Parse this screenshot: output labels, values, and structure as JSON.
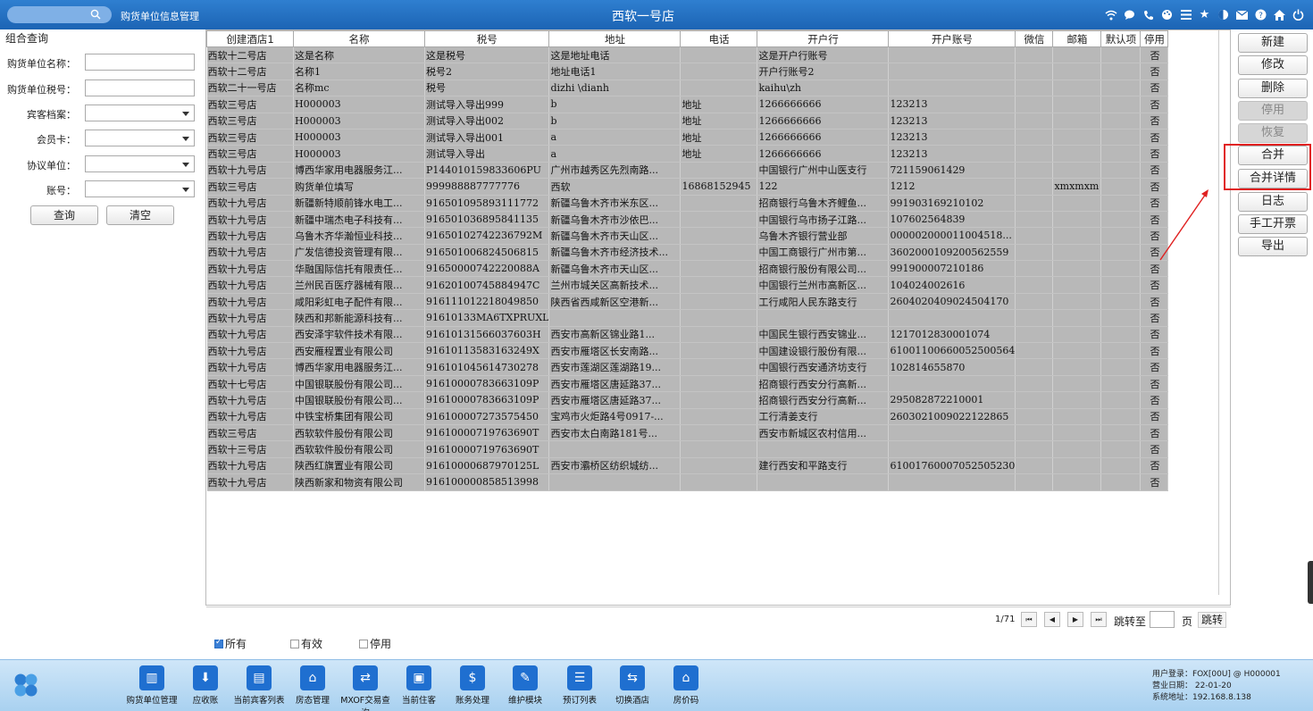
{
  "topbar": {
    "search_placeholder": "",
    "module_title": "购货单位信息管理",
    "store_title": "西软一号店",
    "icons": [
      "wifi-icon",
      "chat-icon",
      "phone-icon",
      "palette-icon",
      "menu-icon",
      "star-icon",
      "moon-icon",
      "mail-icon",
      "help-icon",
      "home-icon",
      "power-icon"
    ]
  },
  "left": {
    "group_title": "组合查询",
    "fields": [
      {
        "label": "购货单位名称：",
        "value": ""
      },
      {
        "label": "购货单位税号：",
        "value": ""
      },
      {
        "label": "宾客档案：",
        "value": ""
      },
      {
        "label": "会员卡：",
        "value": ""
      },
      {
        "label": "协议单位：",
        "value": ""
      },
      {
        "label": "账号：",
        "value": ""
      }
    ],
    "query_label": "查询",
    "clear_label": "清空"
  },
  "grid": {
    "columns": [
      "创建酒店1",
      "名称",
      "税号",
      "地址",
      "电话",
      "开户行",
      "开户账号",
      "微信",
      "邮箱",
      "默认项",
      "停用"
    ],
    "rows": [
      [
        "西软十二号店",
        "这是名称",
        "这是税号",
        "这是地址电话",
        "",
        "这是开户行账号",
        "",
        "",
        "",
        "",
        "否"
      ],
      [
        "西软十二号店",
        "名称1",
        "税号2",
        "地址电话1",
        "",
        "开户行账号2",
        "",
        "",
        "",
        "",
        "否"
      ],
      [
        "西软二十一号店",
        "名称mc",
        "税号",
        "dizhi \\dianh",
        "",
        "kaihu\\zh",
        "",
        "",
        "",
        "",
        "否"
      ],
      [
        "西软三号店",
        "H000003",
        "测试导入导出999",
        "b",
        "地址",
        "1266666666",
        "123213",
        "",
        "",
        "",
        "否"
      ],
      [
        "西软三号店",
        "H000003",
        "测试导入导出002",
        "b",
        "地址",
        "1266666666",
        "123213",
        "",
        "",
        "",
        "否"
      ],
      [
        "西软三号店",
        "H000003",
        "测试导入导出001",
        "a",
        "地址",
        "1266666666",
        "123213",
        "",
        "",
        "",
        "否"
      ],
      [
        "西软三号店",
        "H000003",
        "测试导入导出",
        "a",
        "地址",
        "1266666666",
        "123213",
        "",
        "",
        "",
        "否"
      ],
      [
        "西软十九号店",
        "博西华家用电器服务江...",
        "P144010159833606PU",
        "广州市越秀区先烈南路...",
        "",
        "中国银行广州中山医支行",
        "721159061429",
        "",
        "",
        "",
        "否"
      ],
      [
        "西软三号店",
        "购货单位填写",
        "999988887777776",
        "西软",
        "16868152945",
        "122",
        "1212",
        "",
        "xmxmxm",
        "",
        "否"
      ],
      [
        "西软十九号店",
        "新疆新特顺前锋水电工...",
        "916501095893111772",
        "新疆乌鲁木齐市米东区...",
        "",
        "招商银行乌鲁木齐鲤鱼...",
        "991903169210102",
        "",
        "",
        "",
        "否"
      ],
      [
        "西软十九号店",
        "新疆中瑞杰电子科技有...",
        "916501036895841135",
        "新疆乌鲁木齐市沙依巴...",
        "",
        "中国银行乌市扬子江路...",
        "107602564839",
        "",
        "",
        "",
        "否"
      ],
      [
        "西软十九号店",
        "乌鲁木齐华瀚恒业科技...",
        "91650102742236792M",
        "新疆乌鲁木齐市天山区...",
        "",
        "乌鲁木齐银行营业部",
        "000002000011004518...",
        "",
        "",
        "",
        "否"
      ],
      [
        "西软十九号店",
        "广发信德投资管理有限...",
        "916501006824506815",
        "新疆乌鲁木齐市经济技术...",
        "",
        "中国工商银行广州市第...",
        "3602000109200562559",
        "",
        "",
        "",
        "否"
      ],
      [
        "西软十九号店",
        "华融国际信托有限责任...",
        "91650000742220088A",
        "新疆乌鲁木齐市天山区...",
        "",
        "招商银行股份有限公司...",
        "991900007210186",
        "",
        "",
        "",
        "否"
      ],
      [
        "西软十九号店",
        "兰州民百医疗器械有限...",
        "91620100745884947C",
        "兰州市城关区高新技术...",
        "",
        "中国银行兰州市高新区...",
        "104024002616",
        "",
        "",
        "",
        "否"
      ],
      [
        "西软十九号店",
        "咸阳彩虹电子配件有限...",
        "916111012218049850",
        "陕西省西咸新区空港新...",
        "",
        "工行咸阳人民东路支行",
        "2604020409024504170",
        "",
        "",
        "",
        "否"
      ],
      [
        "西软十九号店",
        "陕西和邦新能源科技有...",
        "91610133MA6TXPRUXL",
        "",
        "",
        "",
        "",
        "",
        "",
        "",
        "否"
      ],
      [
        "西软十九号店",
        "西安泽宇软件技术有限...",
        "91610131566037603H",
        "西安市高新区锦业路1...",
        "",
        "中国民生银行西安锦业...",
        "1217012830001074",
        "",
        "",
        "",
        "否"
      ],
      [
        "西软十九号店",
        "西安雁程置业有限公司",
        "91610113583163249X",
        "西安市雁塔区长安南路...",
        "",
        "中国建设银行股份有限...",
        "61001100660052500564",
        "",
        "",
        "",
        "否"
      ],
      [
        "西软十九号店",
        "博西华家用电器服务江...",
        "916101045614730278",
        "西安市莲湖区莲湖路19...",
        "",
        "中国银行西安通济坊支行",
        "102814655870",
        "",
        "",
        "",
        "否"
      ],
      [
        "西软十七号店",
        "中国银联股份有限公司...",
        "91610000783663109P",
        "西安市雁塔区唐延路37...",
        "",
        "招商银行西安分行高新...",
        "",
        "",
        "",
        "",
        "否"
      ],
      [
        "西软十九号店",
        "中国银联股份有限公司...",
        "91610000783663109P",
        "西安市雁塔区唐延路37...",
        "",
        "招商银行西安分行高新...",
        "295082872210001",
        "",
        "",
        "",
        "否"
      ],
      [
        "西软十九号店",
        "中铁宝桥集团有限公司",
        "916100007273575450",
        "宝鸡市火炬路4号0917-...",
        "",
        "工行清姜支行",
        "2603021009022122865",
        "",
        "",
        "",
        "否"
      ],
      [
        "西软三号店",
        "西软软件股份有限公司",
        "91610000719763690T",
        "西安市太白南路181号...",
        "",
        "西安市新城区农村信用...",
        "",
        "",
        "",
        "",
        "否"
      ],
      [
        "西软十三号店",
        "西软软件股份有限公司",
        "91610000719763690T",
        "",
        "",
        "",
        "",
        "",
        "",
        "",
        "否"
      ],
      [
        "西软十九号店",
        "陕西红旗置业有限公司",
        "91610000687970125L",
        "西安市灞桥区纺织城纺...",
        "",
        "建行西安和平路支行",
        "61001760007052505230",
        "",
        "",
        "",
        "否"
      ],
      [
        "西软十九号店",
        "陕西新家和物资有限公司",
        "916100000858513998",
        "",
        "",
        "",
        "",
        "",
        "",
        "",
        "否"
      ]
    ]
  },
  "pager": {
    "page_info": "1/71",
    "first": "⏮",
    "prev": "◀",
    "next": "▶",
    "last": "⏭",
    "jump_label": "跳转至",
    "jump_value": "",
    "page_label": "页",
    "jump_button": "跳转"
  },
  "filters": [
    {
      "label": "所有",
      "checked": true
    },
    {
      "label": "有效",
      "checked": false
    },
    {
      "label": "停用",
      "checked": false
    }
  ],
  "actions": [
    {
      "label": "新建",
      "disabled": false
    },
    {
      "label": "修改",
      "disabled": false
    },
    {
      "label": "删除",
      "disabled": false
    },
    {
      "label": "停用",
      "disabled": true
    },
    {
      "label": "恢复",
      "disabled": true
    },
    {
      "label": "合并",
      "disabled": false
    },
    {
      "label": "合并详情",
      "disabled": false
    },
    {
      "label": "日志",
      "disabled": false
    },
    {
      "label": "手工开票",
      "disabled": false
    },
    {
      "label": "导出",
      "disabled": false
    }
  ],
  "taskbar": {
    "items": [
      {
        "label": "购货单位管理",
        "icon": "building-icon"
      },
      {
        "label": "应收账",
        "icon": "download-icon"
      },
      {
        "label": "当前宾客列表",
        "icon": "contact-icon"
      },
      {
        "label": "房态管理",
        "icon": "house-icon"
      },
      {
        "label": "MXOF交易查询",
        "icon": "exchange-icon"
      },
      {
        "label": "当前住客",
        "icon": "id-card-icon"
      },
      {
        "label": "账务处理",
        "icon": "money-icon"
      },
      {
        "label": "维护模块",
        "icon": "wrench-icon"
      },
      {
        "label": "预订列表",
        "icon": "list-icon"
      },
      {
        "label": "切换酒店",
        "icon": "switch-icon"
      },
      {
        "label": "房价码",
        "icon": "home-price-icon"
      }
    ],
    "status": {
      "user": "用户登录：FOX[00U] @ H000001",
      "date": "营业日期：  22-01-20",
      "ip": "系统地址：192.168.8.138"
    }
  },
  "colors": {
    "accent": "#1c64b4",
    "highlight": "#e02020",
    "row_bg": "#b8b8b8"
  }
}
